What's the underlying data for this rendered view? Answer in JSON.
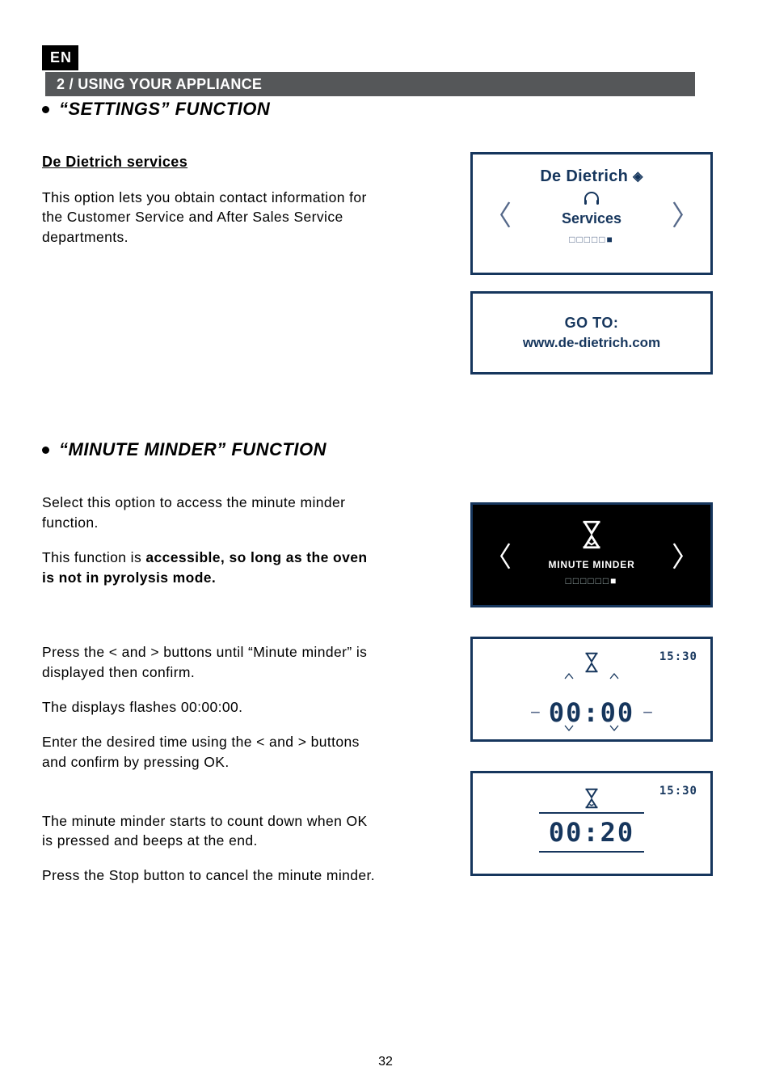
{
  "header": {
    "lang": "EN",
    "title": "2 / USING YOUR APPLIANCE"
  },
  "settings": {
    "title": "“SETTINGS” FUNCTION",
    "subheading": "De Dietrich services",
    "desc": "This option lets you obtain contact information for the Customer Service and After Sales Service departments.",
    "screen": {
      "brand": "De Dietrich",
      "label": "Services",
      "progress_total": 6,
      "progress_filled": 6
    },
    "goto": {
      "title": "GO TO:",
      "url": "www.de-dietrich.com"
    }
  },
  "minute": {
    "title": "“MINUTE MINDER” FUNCTION",
    "p1a": "Select this option to access the minute minder function.",
    "p1b_prefix": "This function is ",
    "p1b_bold": "accessible, so long as the oven is not in pyrolysis mode.",
    "p2": "Press the < and > buttons until “Minute minder” is displayed then confirm.",
    "p3": "The displays flashes 00:00:00.",
    "p4": "Enter the desired time using the < and > buttons and confirm by pressing OK.",
    "p5": "The minute minder starts to count down when OK is pressed and beeps at the end.",
    "p6": "Press the Stop button to cancel the minute minder.",
    "screen_select": {
      "label": "MINUTE MINDER",
      "progress_total": 7,
      "progress_filled": 7
    },
    "screen_set": {
      "clock": "15:30",
      "time": "00:00"
    },
    "screen_run": {
      "clock": "15:30",
      "time": "00:20"
    }
  },
  "page_number": "32"
}
